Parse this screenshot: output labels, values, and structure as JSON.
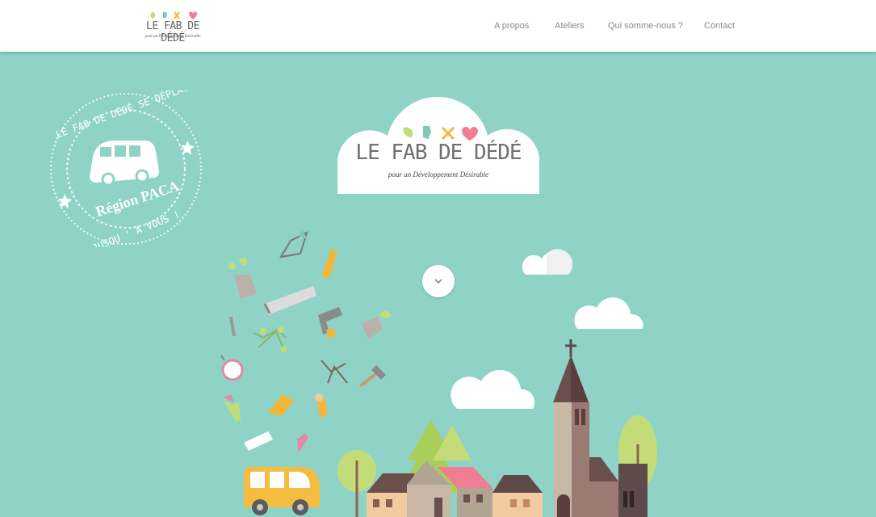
{
  "brand": {
    "logo_text": "LE FAB DE DÉDÉ",
    "logo_subtitle": "pour un Développement Désirable"
  },
  "nav": {
    "items": [
      {
        "label": "A propos"
      },
      {
        "label": "Ateliers"
      },
      {
        "label": "Qui somme-nous ?"
      },
      {
        "label": "Contact"
      }
    ]
  },
  "stamp": {
    "top_text": "LE FAB DE DÉDÉ SE DÉPLACE",
    "region": "Région PACA",
    "bottom_text": "JUSQU ' A VOUS !"
  },
  "hero": {
    "title": "LE FAB DE DÉDÉ",
    "subtitle": "pour un Développement Désirable"
  },
  "icons": {
    "scroll": "chevron-down-icon",
    "leaf": "leaf-icon",
    "glove": "glove-icon",
    "tools": "tools-icon",
    "heart": "heart-icon"
  },
  "colors": {
    "background": "#8fd3c7",
    "leaf": "#c3dc78",
    "glove": "#7ec9b6",
    "tools": "#f1b73c",
    "heart": "#ef7d93",
    "bus": "#f4bd3f"
  }
}
